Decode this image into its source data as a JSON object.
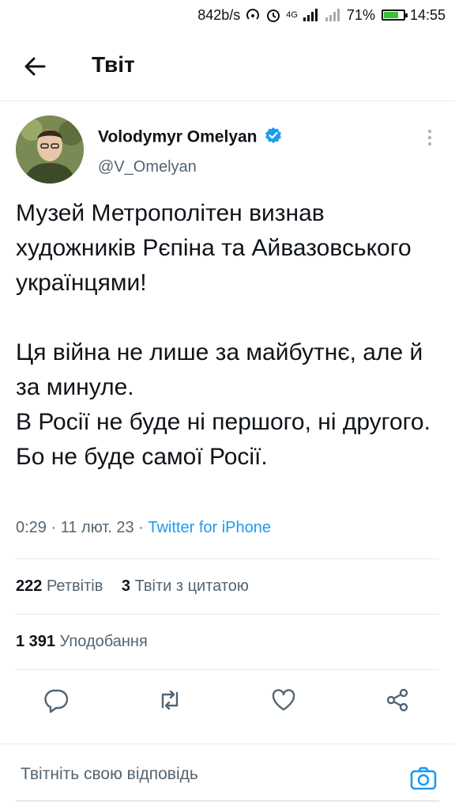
{
  "status_bar": {
    "speed": "842b/s",
    "network": "4G",
    "battery": "71%",
    "time": "14:55"
  },
  "header": {
    "title": "Твіт",
    "back_icon": "arrow-left-icon"
  },
  "tweet": {
    "author_name": "Volodymyr Omelyan",
    "author_handle": "@V_Omelyan",
    "verified": true,
    "text": "Музей Метрополітен визнав художників Рєпіна та Айвазовського українцями!\n\nЦя війна не лише за майбутнє, але й за минуле.\nВ Росії не буде ні першого, ні другого.\nБо не буде самої Росії.",
    "time": "0:29",
    "date": "11 лют. 23",
    "source": "Twitter for iPhone"
  },
  "stats": {
    "retweets_count": "222",
    "retweets_label": "Ретвітів",
    "quotes_count": "3",
    "quotes_label": "Твіти з цитатою",
    "likes_count": "1 391",
    "likes_label": "Уподобання"
  },
  "actions": [
    "reply-icon",
    "retweet-icon",
    "like-icon",
    "share-icon"
  ],
  "reply": {
    "placeholder": "Твітніть свою відповідь"
  },
  "colors": {
    "accent": "#1d9bf0",
    "secondary_text": "#536471",
    "primary_text": "#0f1419",
    "battery": "#3ac13a"
  }
}
